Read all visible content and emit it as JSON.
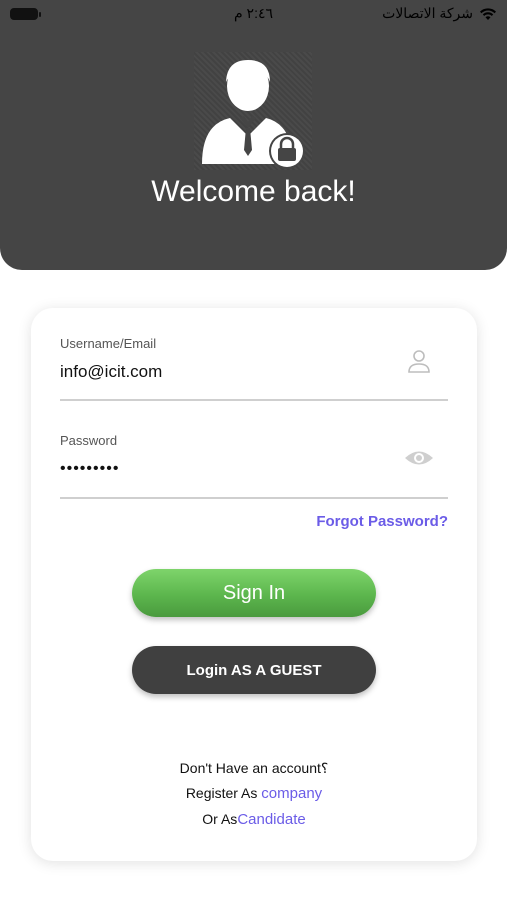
{
  "status_bar": {
    "carrier": "شركة الاتصالات",
    "time": "٢:٤٦ م"
  },
  "header": {
    "title": "Welcome back!",
    "avatar_icon": "user-lock-icon"
  },
  "form": {
    "username": {
      "label": "Username/Email",
      "value": "info@icit.com",
      "icon": "user-icon"
    },
    "password": {
      "label": "Password",
      "value": "•••••••••",
      "icon": "eye-icon"
    },
    "forgot_password": "Forgot Password?",
    "sign_in_label": "Sign In",
    "guest_login_label": "Login AS A GUEST"
  },
  "footer": {
    "no_account": "Don't Have an account؟",
    "register_prefix": "Register As",
    "register_company": "company",
    "or_as_prefix": "Or As",
    "register_candidate": "Candidate"
  },
  "colors": {
    "header_bg": "#454545",
    "link": "#6b5ce7",
    "sign_in_green": "#5cb64d",
    "guest_button": "#404040"
  }
}
